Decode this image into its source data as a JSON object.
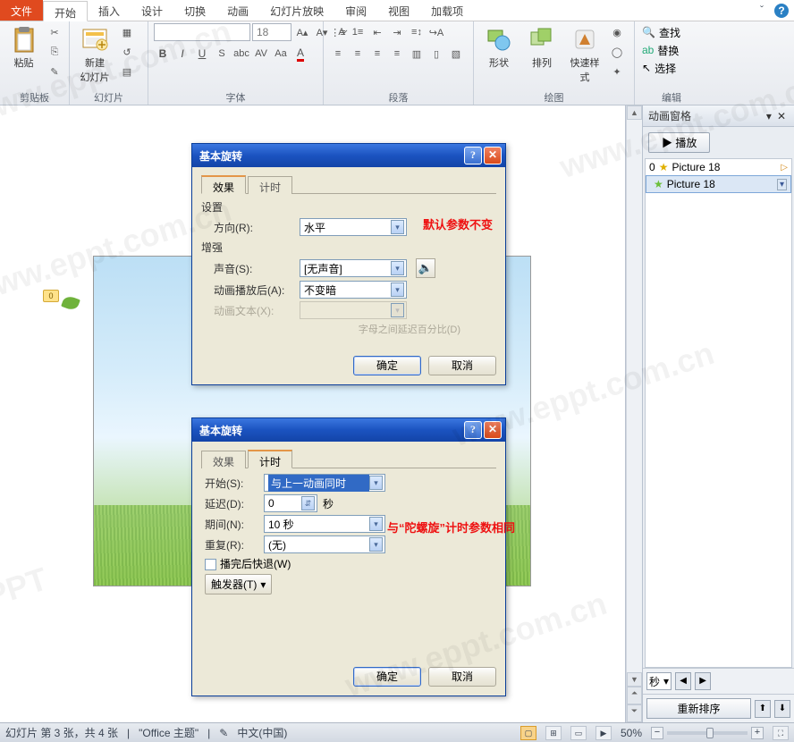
{
  "tabs": {
    "file": "文件",
    "start": "开始",
    "insert": "插入",
    "design": "设计",
    "transition": "切换",
    "animation": "动画",
    "slideshow": "幻灯片放映",
    "review": "审阅",
    "view": "视图",
    "addins": "加载项"
  },
  "ribbon": {
    "clipboard": {
      "paste": "粘贴",
      "label": "剪贴板"
    },
    "slides": {
      "new": "新建\n幻灯片",
      "label": "幻灯片"
    },
    "font": {
      "size": "18",
      "label": "字体"
    },
    "para": {
      "label": "段落"
    },
    "draw": {
      "shapes": "形状",
      "arrange": "排列",
      "quick": "快速样式",
      "label": "绘图"
    },
    "editing": {
      "find": "查找",
      "replace": "替换",
      "select": "选择",
      "label": "编辑"
    }
  },
  "anim_pane": {
    "title": "动画窗格",
    "play": "播放",
    "items": [
      {
        "idx": "0",
        "name": "Picture 18",
        "selected": false
      },
      {
        "idx": "",
        "name": "Picture 18",
        "selected": true
      }
    ],
    "seconds": "秒",
    "reorder": "重新排序"
  },
  "dlg1": {
    "title": "基本旋转",
    "tab_effect": "效果",
    "tab_timing": "计时",
    "grp_settings": "设置",
    "direction_label": "方向(R):",
    "direction_value": "水平",
    "grp_enhance": "增强",
    "sound_label": "声音(S):",
    "sound_value": "[无声音]",
    "after_label": "动画播放后(A):",
    "after_value": "不变暗",
    "text_label": "动画文本(X):",
    "sub": "字母之间延迟百分比(D)",
    "ok": "确定",
    "cancel": "取消",
    "note": "默认参数不变"
  },
  "dlg2": {
    "title": "基本旋转",
    "tab_effect": "效果",
    "tab_timing": "计时",
    "start_label": "开始(S):",
    "start_value": "与上一动画同时",
    "delay_label": "延迟(D):",
    "delay_value": "0",
    "delay_unit": "秒",
    "period_label": "期间(N):",
    "period_value": "10 秒",
    "repeat_label": "重复(R):",
    "repeat_value": "(无)",
    "rewind": "播完后快退(W)",
    "trigger": "触发器(T)",
    "ok": "确定",
    "cancel": "取消",
    "note": "与“陀螺旋”计时参数相同"
  },
  "status": {
    "slide": "幻灯片 第 3 张，共 4 张",
    "theme": "\"Office 主题\"",
    "lang": "中文(中国)",
    "zoom": "50%"
  },
  "tag0": "0"
}
